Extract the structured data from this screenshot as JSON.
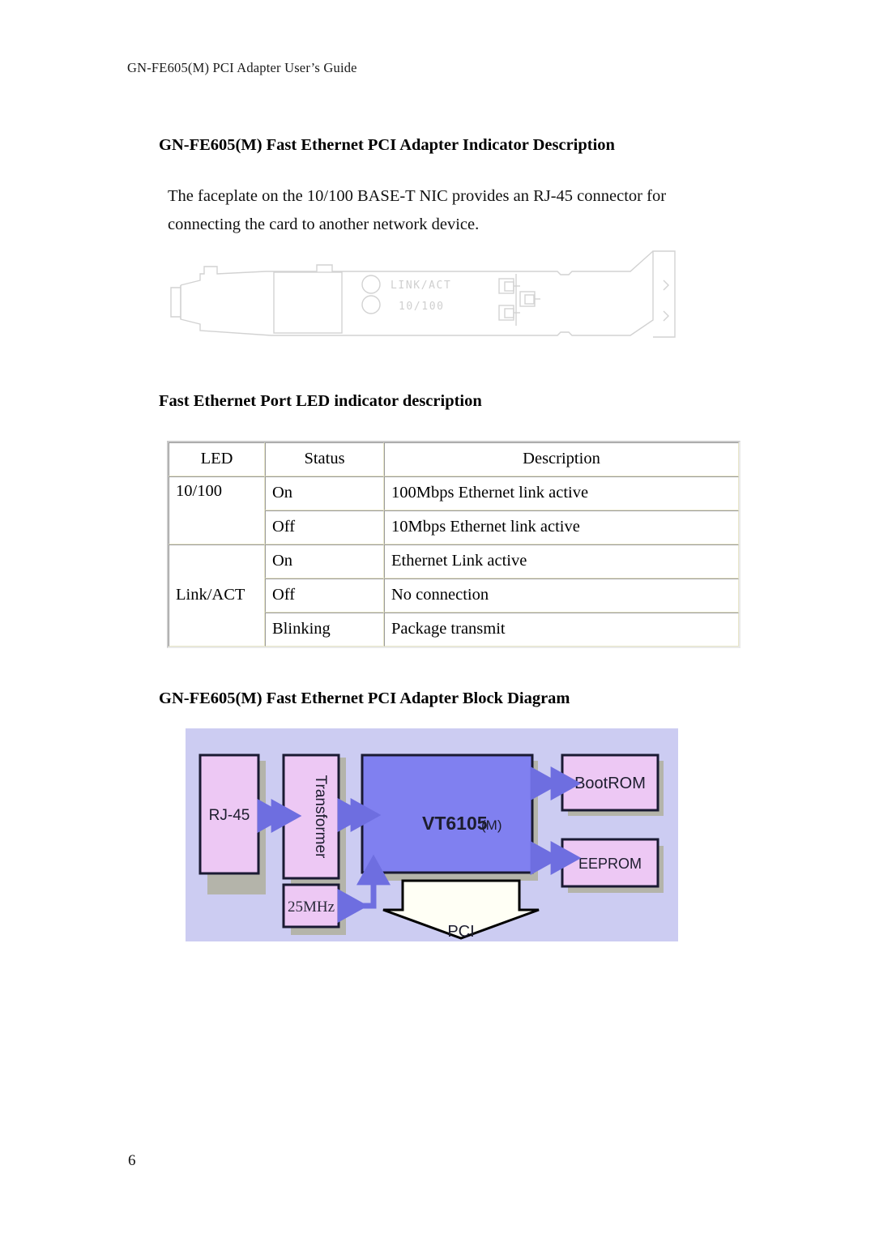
{
  "document": {
    "running_header": "GN-FE605(M) PCI Adapter User’s Guide",
    "page_number": "6"
  },
  "sections": {
    "indicator": {
      "heading": "GN-FE605(M) Fast Ethernet PCI Adapter Indicator Description",
      "paragraph_line1": "The faceplate on the 10/100 BASE-T NIC provides an RJ-45 connector for",
      "paragraph_line2": "connecting the card to another network device."
    },
    "led_section": {
      "heading": "Fast Ethernet Port LED indicator description"
    },
    "block_section": {
      "heading": "GN-FE605(M) Fast Ethernet PCI Adapter Block Diagram"
    }
  },
  "faceplate": {
    "led_labels": [
      "LINK/ACT",
      "10/100"
    ],
    "line_color": "#d2d2d2"
  },
  "led_table": {
    "columns": [
      "LED",
      "Status",
      "Description"
    ],
    "rows": [
      {
        "led": "10/100",
        "status": "On",
        "description": "100Mbps Ethernet link active"
      },
      {
        "led": "",
        "status": "Off",
        "description": "10Mbps Ethernet link active"
      },
      {
        "led": "",
        "status": "On",
        "description": "Ethernet Link active"
      },
      {
        "led": "Link/ACT",
        "status": "Off",
        "description": "No connection"
      },
      {
        "led": "",
        "status": "Blinking",
        "description": "Package transmit"
      }
    ],
    "led_groups": [
      {
        "label": "10/100",
        "rowspan": 2
      },
      {
        "label": "Link/ACT",
        "rowspan": 3
      }
    ]
  },
  "block_diagram": {
    "type": "diagram",
    "background_color": "#ccccf2",
    "shadow_color": "#b4b4aa",
    "arrow_color": "#6e6ee0",
    "box_fill": "#edc8f4",
    "box_border": "#1a1a33",
    "chip_fill": "#8080f0",
    "blocks": [
      {
        "name": "rj45",
        "label": "RJ-45",
        "orientation": "horizontal"
      },
      {
        "name": "transformer",
        "label": "Transformer",
        "orientation": "vertical"
      },
      {
        "name": "clock",
        "label": "25MHz",
        "orientation": "horizontal"
      },
      {
        "name": "chip",
        "label": "VT6105",
        "label_suffix": "(M)",
        "orientation": "horizontal"
      },
      {
        "name": "bootrom",
        "label": "BootROM",
        "orientation": "horizontal"
      },
      {
        "name": "eeprom",
        "label": "EEPROM",
        "orientation": "horizontal"
      },
      {
        "name": "bus",
        "label": "PCI",
        "orientation": "horizontal"
      }
    ],
    "connections": [
      {
        "from": "rj45",
        "to": "transformer",
        "style": "double"
      },
      {
        "from": "transformer",
        "to": "chip",
        "style": "double"
      },
      {
        "from": "chip",
        "to": "bootrom",
        "style": "double"
      },
      {
        "from": "chip",
        "to": "eeprom",
        "style": "double"
      },
      {
        "from": "chip",
        "to": "clock",
        "style": "double"
      },
      {
        "from": "chip",
        "to": "bus",
        "style": "arrow-down"
      }
    ]
  }
}
